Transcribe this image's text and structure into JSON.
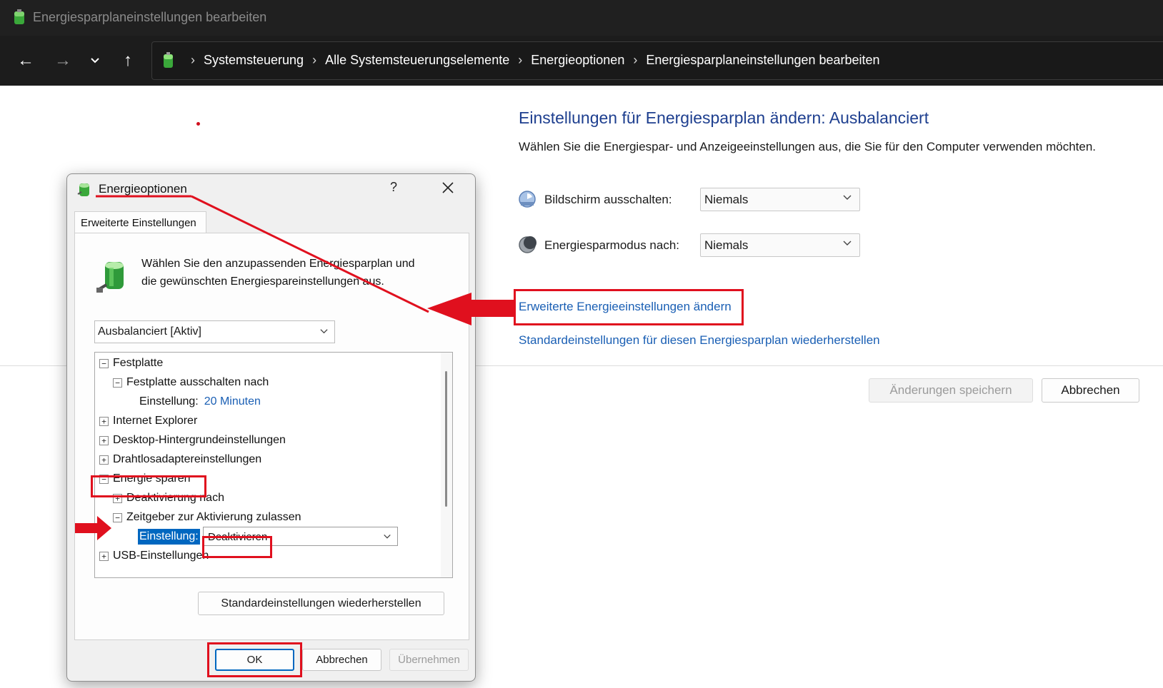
{
  "window": {
    "title": "Energiesparplaneinstellungen bearbeiten"
  },
  "nav": {
    "back_icon": "←",
    "forward_icon": "→",
    "recent_icon": "⌄",
    "up_icon": "↑",
    "breadcrumbs": [
      "Systemsteuerung",
      "Alle Systemsteuerungselemente",
      "Energieoptionen",
      "Energiesparplaneinstellungen bearbeiten"
    ],
    "separator": "›"
  },
  "main": {
    "title": "Einstellungen für Energiesparplan ändern: Ausbalanciert",
    "description": "Wählen Sie die Energiespar- und Anzeigeeinstellungen aus, die Sie für den Computer verwenden möchten.",
    "display_off_label": "Bildschirm ausschalten:",
    "display_off_value": "Niemals",
    "sleep_label": "Energiesparmodus nach:",
    "sleep_value": "Niemals",
    "advanced_link": "Erweiterte Energieeinstellungen ändern",
    "restore_link": "Standardeinstellungen für diesen Energiesparplan wiederherstellen",
    "save_button": "Änderungen speichern",
    "cancel_button": "Abbrechen"
  },
  "dialog": {
    "title": "Energieoptionen",
    "help": "?",
    "tab": "Erweiterte Einstellungen",
    "intro_line1": "Wählen Sie den anzupassenden Energiesparplan und",
    "intro_line2": "die gewünschten Energiespareinstellungen aus.",
    "plan_selected": "Ausbalanciert [Aktiv]",
    "tree": {
      "festplatte": "Festplatte",
      "festplatte_aus": "Festplatte ausschalten nach",
      "einstellung_label": "Einstellung:",
      "festplatte_value": "20 Minuten",
      "internet_explorer": "Internet Explorer",
      "desktop_bg": "Desktop-Hintergrundeinstellungen",
      "wireless": "Drahtlosadaptereinstellungen",
      "energie_sparen": "Energie sparen",
      "deaktivierung": "Deaktivierung nach",
      "zeitgeber": "Zeitgeber zur Aktivierung zulassen",
      "selected_setting_label": "Einstellung:",
      "selected_setting_value": "Deaktivieren",
      "usb": "USB-Einstellungen"
    },
    "restore_defaults": "Standardeinstellungen wiederherstellen",
    "ok": "OK",
    "cancel": "Abbrechen",
    "apply": "Übernehmen"
  },
  "colors": {
    "accent_blue": "#0067c0",
    "link_blue": "#1a5fb4",
    "title_blue": "#1e3f8f",
    "annotation_red": "#e0101e",
    "titlebar_bg": "#202020"
  }
}
